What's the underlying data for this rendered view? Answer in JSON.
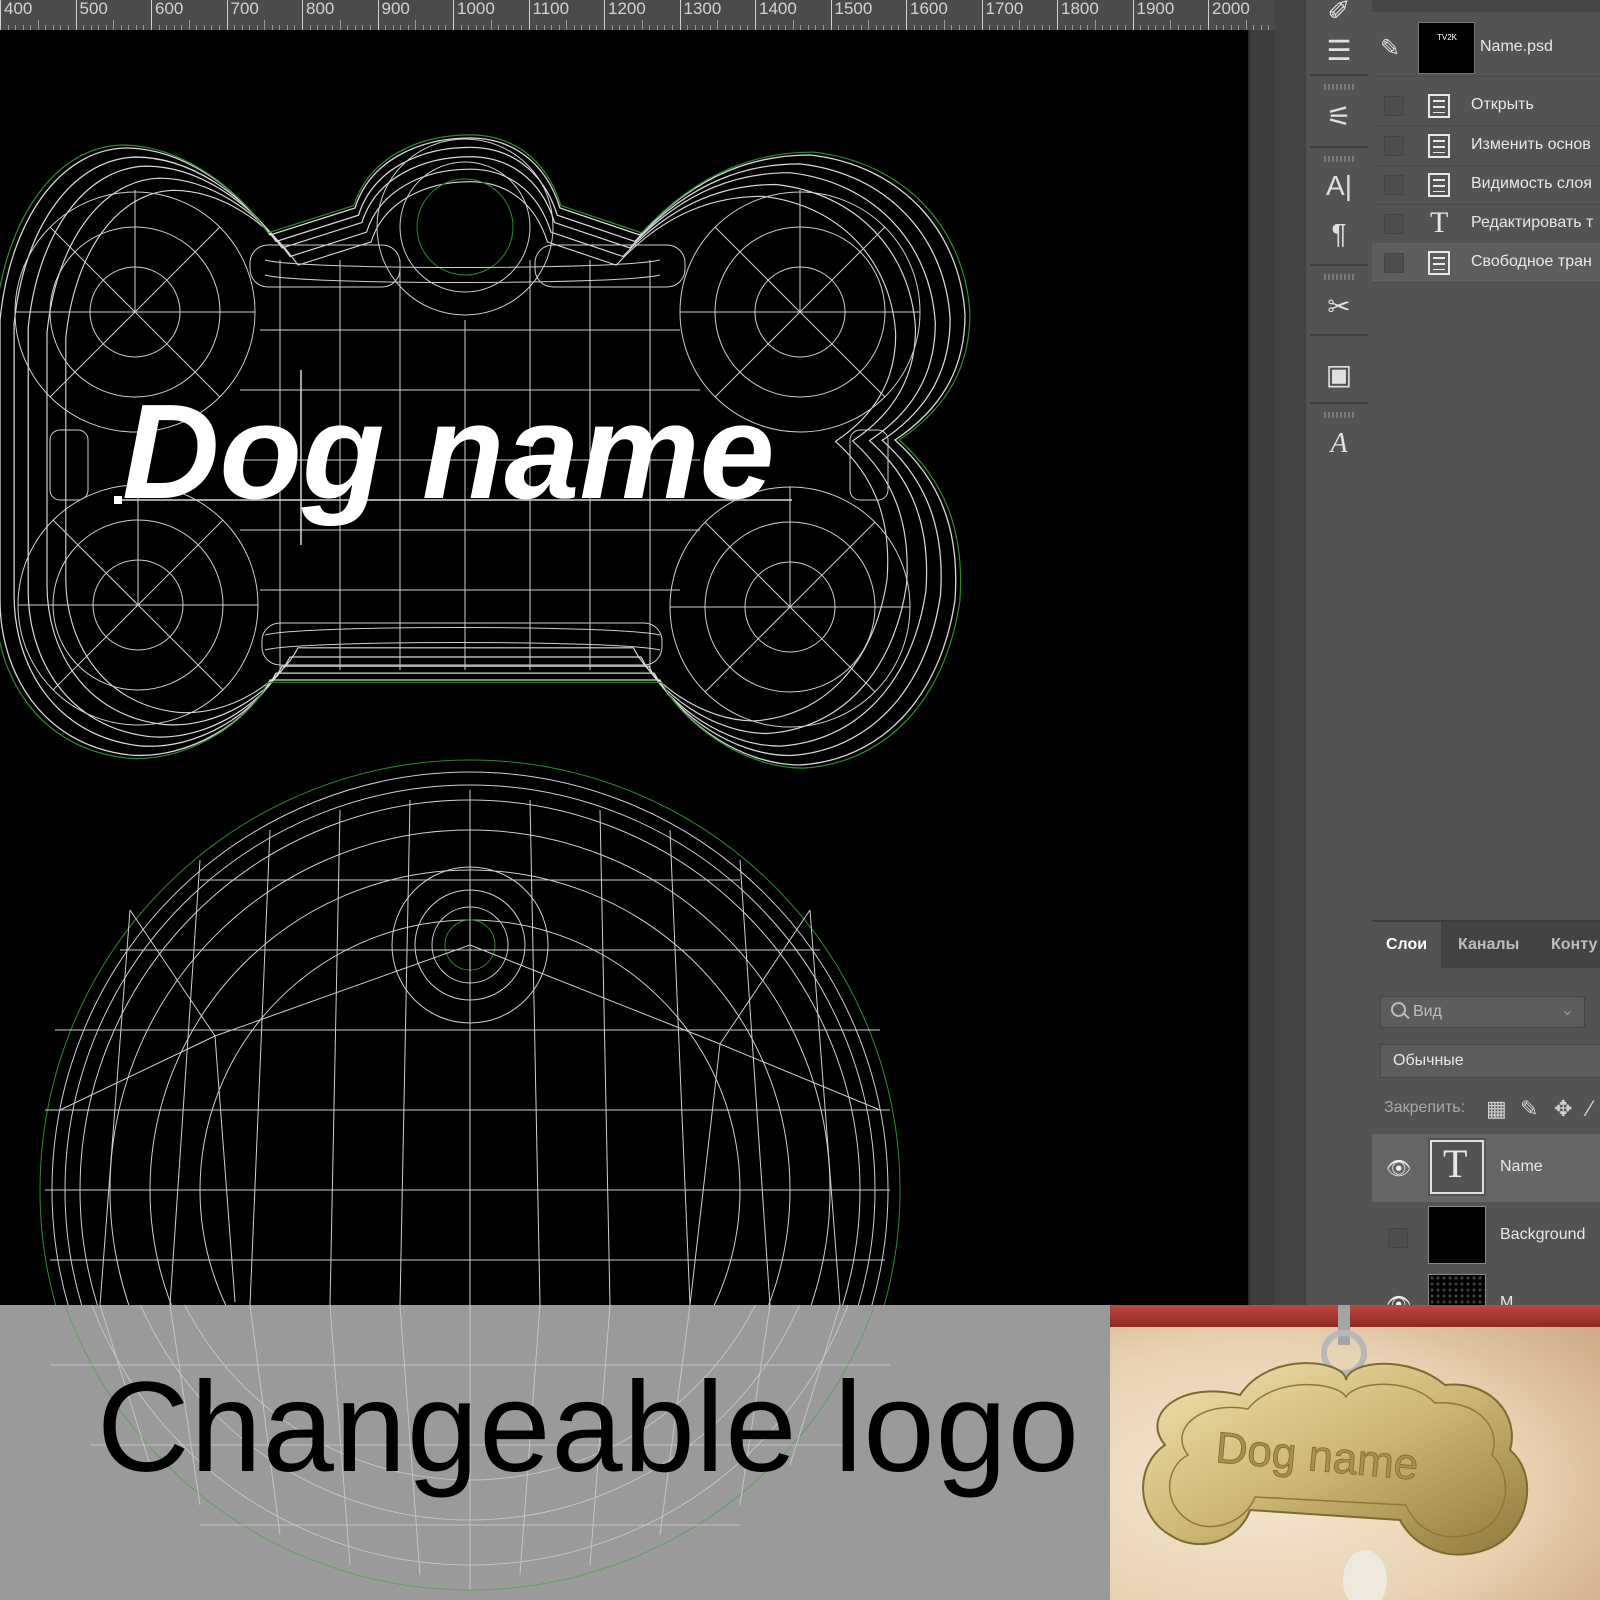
{
  "ruler": {
    "labels": [
      "400",
      "500",
      "600",
      "700",
      "800",
      "900",
      "1000",
      "1100",
      "1200",
      "1300",
      "1400",
      "1500",
      "1600",
      "1700",
      "1800",
      "1900",
      "2000"
    ]
  },
  "canvas": {
    "text_layer_content": "Dog name"
  },
  "history": {
    "snapshot": {
      "thumb_text": "TV2K",
      "name": "Name.psd"
    },
    "items": [
      {
        "icon": "document-icon",
        "label": "Открыть"
      },
      {
        "icon": "document-icon",
        "label": "Изменить основ"
      },
      {
        "icon": "document-icon",
        "label": "Видимость слоя"
      },
      {
        "icon": "type-icon",
        "label": "Редактировать т"
      },
      {
        "icon": "document-icon",
        "label": "Свободное тран"
      }
    ]
  },
  "layers_panel": {
    "tabs": [
      "Слои",
      "Каналы",
      "Конту"
    ],
    "search_placeholder": "Вид",
    "blend_mode": "Обычные",
    "lock_label": "Закрепить:",
    "layers": [
      {
        "name": "Name",
        "kind": "text",
        "visible": true,
        "selected": true
      },
      {
        "name": "Background",
        "kind": "image",
        "visible": false,
        "selected": false
      },
      {
        "name": "M...",
        "kind": "image",
        "visible": true,
        "selected": false
      }
    ]
  },
  "banner": {
    "text": "Changeable logo"
  },
  "render": {
    "tag_text": "Dog name"
  },
  "colors": {
    "ui_dark": "#535353",
    "wire": "#d8d8d8",
    "outline_green": "#2f8a2f",
    "banner_bg": "#9a9a9a",
    "gold": "#cdb774"
  }
}
